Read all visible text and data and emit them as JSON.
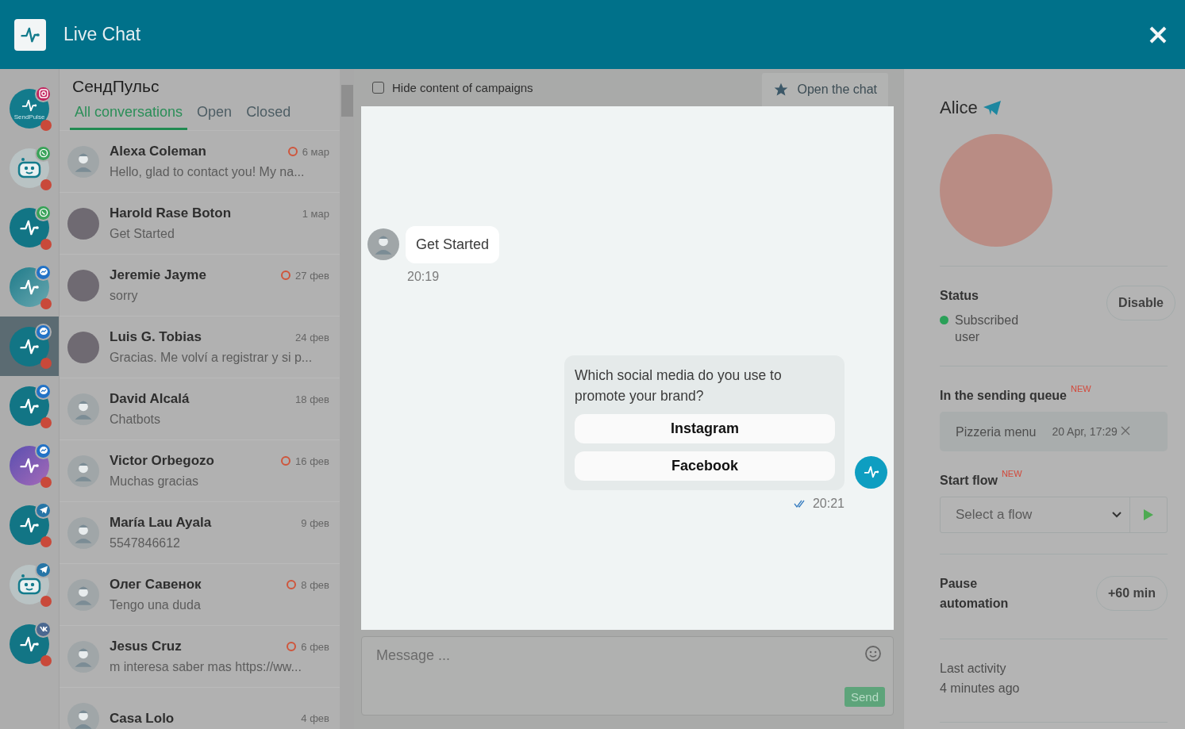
{
  "header": {
    "title": "Live Chat"
  },
  "channels": [
    {
      "kind": "brand",
      "caption": "SendPulse",
      "badge": {
        "kind": "instagram"
      },
      "selected": false
    },
    {
      "kind": "bot",
      "badge": {
        "kind": "whatsapp"
      },
      "selected": false
    },
    {
      "kind": "logo",
      "badge": {
        "kind": "whatsapp"
      },
      "selected": false
    },
    {
      "kind": "fade",
      "badge": {
        "kind": "messenger"
      },
      "selected": false
    },
    {
      "kind": "logo",
      "badge": {
        "kind": "messenger"
      },
      "selected": true
    },
    {
      "kind": "logo",
      "badge": {
        "kind": "messenger"
      },
      "selected": false
    },
    {
      "kind": "purple",
      "badge": {
        "kind": "messenger"
      },
      "selected": false
    },
    {
      "kind": "logo",
      "badge": {
        "kind": "telegram"
      },
      "selected": false
    },
    {
      "kind": "bot",
      "badge": {
        "kind": "telegram"
      },
      "selected": false
    },
    {
      "kind": "logo",
      "badge": {
        "kind": "vk"
      },
      "selected": false
    }
  ],
  "inbox": {
    "title": "СендПульс",
    "tabs": [
      {
        "label": "All conversations",
        "selected": true
      },
      {
        "label": "Open",
        "selected": false
      },
      {
        "label": "Closed",
        "selected": false
      }
    ]
  },
  "conversations": [
    {
      "name": "Alexa Coleman",
      "preview": "Hello, glad to contact you! My na...",
      "date": "6 мар",
      "unread": true,
      "kind": "placeholder"
    },
    {
      "name": "Harold Rase Boton",
      "preview": "Get Started",
      "date": "1 мар",
      "unread": false,
      "kind": "photo"
    },
    {
      "name": "Jeremie Jayme",
      "preview": "sorry",
      "date": "27 фев",
      "unread": true,
      "kind": "photo"
    },
    {
      "name": "Luis G. Tobias",
      "preview": "Gracias. Me volví a registrar y si p...",
      "date": "24 фев",
      "unread": false,
      "kind": "photo"
    },
    {
      "name": "David Alcalá",
      "preview": "Chatbots",
      "date": "18 фев",
      "unread": false,
      "kind": "placeholder"
    },
    {
      "name": "Victor Orbegozo",
      "preview": "Muchas gracias",
      "date": "16 фев",
      "unread": true,
      "kind": "placeholder"
    },
    {
      "name": "María Lau Ayala",
      "preview": "5547846612",
      "date": "9 фев",
      "unread": false,
      "kind": "placeholder"
    },
    {
      "name": "Олег Савенок",
      "preview": "Tengo una duda",
      "date": "8 фев",
      "unread": true,
      "kind": "placeholder"
    },
    {
      "name": "Jesus Cruz",
      "preview": "m interesa saber mas https://ww...",
      "date": "6 фев",
      "unread": true,
      "kind": "placeholder"
    },
    {
      "name": "Casa Lolo",
      "date": "4 фев",
      "unread": false,
      "kind": "placeholder"
    }
  ],
  "chat": {
    "hide_campaigns": {
      "label": "Hide content of campaigns",
      "checked": false
    },
    "open_button": "Open the chat",
    "messages": [
      {
        "kind": "incoming",
        "text": "Get Started",
        "time": "20:19"
      },
      {
        "kind": "outgoing",
        "text": "Which social media do you use to promote your brand?",
        "buttons": [
          "Instagram",
          "Facebook"
        ],
        "time": "20:21",
        "read": true
      }
    ],
    "composer": {
      "placeholder": "Message ...",
      "send": "Send"
    }
  },
  "contact": {
    "name": "Alice",
    "status": {
      "label": "Status",
      "value": "Subscribed user",
      "color": "#2aa058",
      "button": "Disable"
    },
    "queue": {
      "heading": "In the sending queue",
      "badge": "NEW",
      "item": "Pizzeria menu",
      "time": "20 Apr, 17:29"
    },
    "flow": {
      "heading": "Start flow",
      "badge": "NEW",
      "placeholder": "Select a flow"
    },
    "pause": {
      "label": "Pause automation",
      "button": "+60 min"
    },
    "activity": {
      "label": "Last activity",
      "value": "4 minutes ago"
    }
  }
}
